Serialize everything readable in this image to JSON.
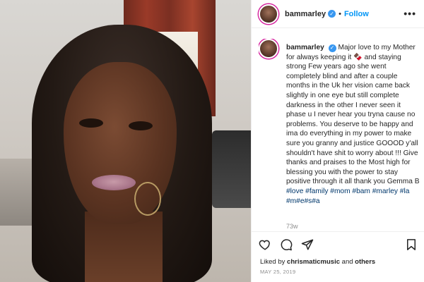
{
  "post": {
    "username": "bammarley",
    "follow_label": "Follow",
    "separator": "•",
    "more_label": "•••"
  },
  "caption": {
    "username": "bammarley",
    "text": "Major love to my Mother for always keeping it 🍫 and staying strong Few years ago she went completely blind and after a couple months in the Uk her vision came back slightly in one eye but still complete darkness in the other I never seen it phase u I never hear you tryna cause no problems. You deserve to be happy and ima do everything in my power to make sure you granny and justice GOOOD y'all shouldn't have shit to worry about !!! Give thanks and praises to the Most high for blessing you with the power to stay positive through it all thank you Gemma B",
    "hashtags": "#love #family #mom #bam #marley #la #m#e#s#a",
    "time_ago": "73w"
  },
  "likes": {
    "prefix": "Liked by",
    "user": "chrismaticmusic",
    "and": "and",
    "others": "others"
  },
  "date": "MAY 25, 2019",
  "icons": {
    "verified": "verified-badge-icon",
    "like": "heart-icon",
    "comment": "comment-icon",
    "share": "share-icon",
    "save": "bookmark-icon"
  },
  "colors": {
    "follow": "#0095f6",
    "verified": "#3897f0",
    "hashtag": "#00376b",
    "muted": "#8e8e8e"
  }
}
